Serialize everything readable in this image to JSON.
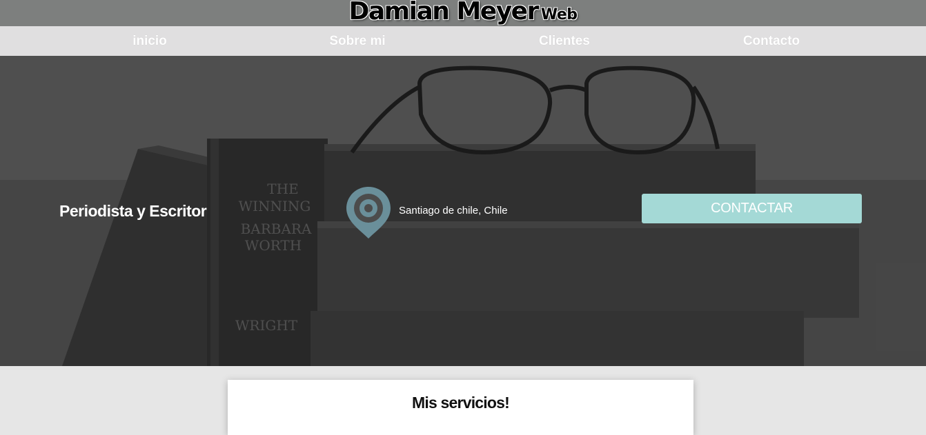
{
  "header": {
    "title": "Damian Meyer",
    "title_suffix": "Web"
  },
  "nav": {
    "items": [
      "inicio",
      "Sobre mi",
      "Clientes",
      "Contacto"
    ]
  },
  "hero": {
    "tagline": "Periodista y Escritor",
    "location": "Santiago de chile, Chile",
    "location_icon": "map-pin-icon",
    "contact_button": "CONTACTAR",
    "accent_color": "#a4d9d6",
    "pin_color": "#6a8f9a"
  },
  "services": {
    "heading": "Mis servicios!"
  }
}
